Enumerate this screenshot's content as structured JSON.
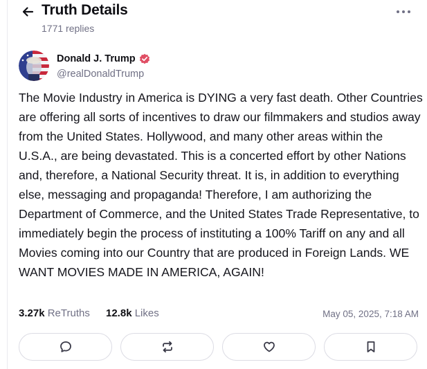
{
  "header": {
    "title": "Truth Details",
    "replies": "1771 replies",
    "back_icon": "arrow-left-icon",
    "more_icon": "more-horizontal-icon"
  },
  "author": {
    "display_name": "Donald J. Trump",
    "handle": "@realDonaldTrump",
    "verified": true,
    "verified_color": "#e04e64"
  },
  "post": {
    "text": "The Movie Industry in America is DYING a very fast death. Other Countries are offering all sorts of incentives to draw our filmmakers and studios away from the United States. Hollywood, and many other areas within the U.S.A., are being devastated. This is a concerted effort by other Nations and, therefore, a National Security threat. It is, in addition to everything else, messaging and propaganda! Therefore, I am authorizing the Department of Commerce, and the United States Trade Representative, to immediately begin the process of instituting a 100% Tariff on any and all Movies coming into our Country that are produced in Foreign Lands. WE WANT MOVIES MADE IN AMERICA, AGAIN!"
  },
  "stats": {
    "retruths_count": "3.27k",
    "retruths_label": "ReTruths",
    "likes_count": "12.8k",
    "likes_label": "Likes",
    "timestamp": "May 05, 2025, 7:18 AM"
  },
  "actions": [
    {
      "name": "reply",
      "icon": "comment-icon"
    },
    {
      "name": "retruth",
      "icon": "repost-icon"
    },
    {
      "name": "like",
      "icon": "heart-icon"
    },
    {
      "name": "bookmark",
      "icon": "bookmark-icon"
    }
  ],
  "colors": {
    "text_primary": "#0f0f14",
    "text_secondary": "#707085",
    "border": "#dcdce4"
  }
}
